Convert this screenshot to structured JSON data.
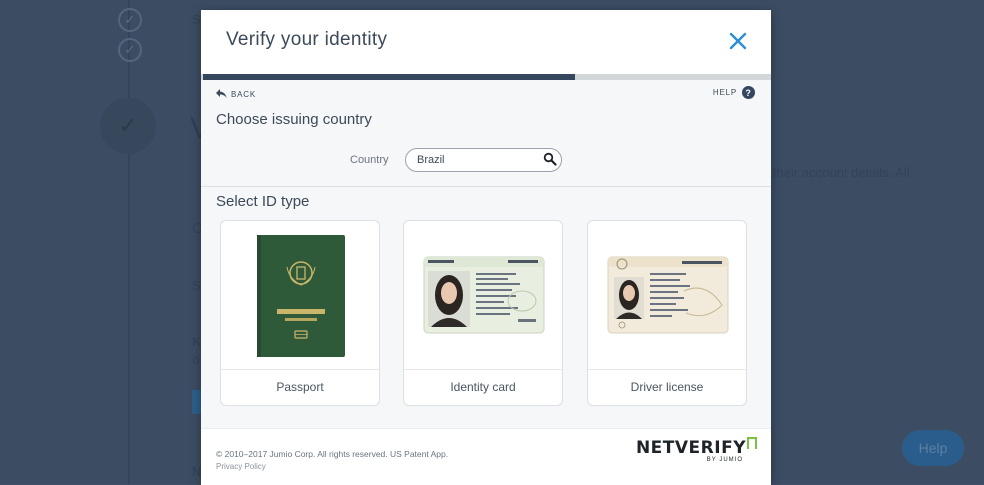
{
  "background": {
    "partial_texts": [
      "S",
      "V",
      "C",
      "S",
      "K",
      "o",
      "N"
    ],
    "paragraph_fragment": "their account details. All",
    "help_button": "Help"
  },
  "modal": {
    "title": "Verify your identity",
    "close_icon": "close-x-icon",
    "progress": {
      "current_step": 1,
      "total_steps": 2
    },
    "nav": {
      "back_label": "BACK",
      "help_label": "HELP",
      "help_icon": "?"
    },
    "country_section": {
      "title": "Choose issuing country",
      "field_label": "Country",
      "value": "Brazil"
    },
    "id_section": {
      "title": "Select ID type",
      "options": [
        {
          "label": "Passport",
          "icon": "passport-image"
        },
        {
          "label": "Identity card",
          "icon": "identity-card-image"
        },
        {
          "label": "Driver license",
          "icon": "driver-license-image"
        }
      ]
    },
    "footer": {
      "copyright": "© 2010–2017 Jumio Corp. All rights reserved. US Patent App.",
      "privacy": "Privacy Policy",
      "brand_main": "NETVERIFY",
      "brand_sub": "BY JUMIO"
    }
  },
  "colors": {
    "accent": "#2a8fd6",
    "progress_active": "#34475f",
    "background_overlay": "#3c4d63",
    "brand_green": "#7cc242"
  }
}
